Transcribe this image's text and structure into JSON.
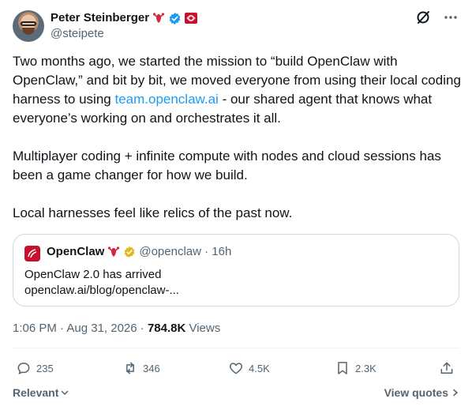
{
  "author": {
    "name": "Peter Steinberger",
    "handle": "@steipete"
  },
  "tweet": {
    "paragraph1_a": "Two months ago, we started the mission to “build OpenClaw with OpenClaw,” and bit by bit, we moved everyone from using their local coding harness to using ",
    "link": "team.openclaw.ai",
    "paragraph1_b": " - our shared agent that knows what everyone’s working on and orchestrates it all.",
    "paragraph2": "Multiplayer coding + infinite compute with nodes and cloud sessions has been a game changer for how we build.",
    "paragraph3": "Local harnesses feel like relics of the past now."
  },
  "quote": {
    "name": "OpenClaw",
    "handle_time": "@openclaw · 16h",
    "line1": "OpenClaw 2.0 has arrived",
    "line2": "openclaw.ai/blog/openclaw-..."
  },
  "meta": {
    "time_date": "1:06 PM · Aug 31, 2026 · ",
    "views_count": "784.8K",
    "views_label": " Views"
  },
  "actions": {
    "replies": "235",
    "reposts": "346",
    "likes": "4.5K",
    "bookmarks": "2.3K"
  },
  "footer": {
    "sort_label": "Relevant",
    "view_quotes_label": "View quotes"
  },
  "colors": {
    "link": "#1d9bf0",
    "verified": "#1d9bf0",
    "gold_badge": "#e2b719",
    "muted": "#536471"
  }
}
